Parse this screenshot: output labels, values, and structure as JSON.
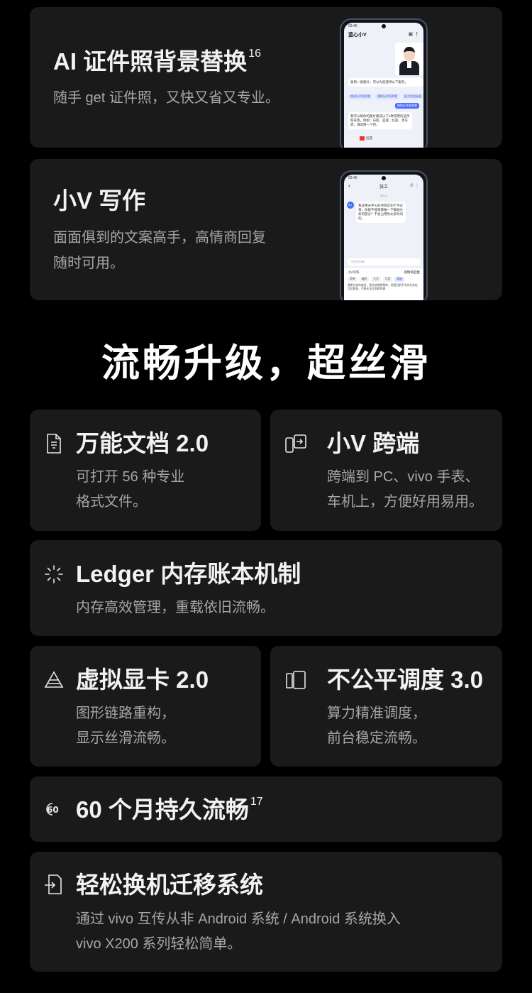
{
  "cards": {
    "ai_photo": {
      "title": "AI 证件照背景替换",
      "sup": "16",
      "desc": "随手 get 证件照，又快又省又专业。"
    },
    "writing": {
      "title": "小V 写作",
      "desc_line1": "面面俱到的文案高手，高情商回复",
      "desc_line2": "随时可用。"
    }
  },
  "phone1": {
    "time": "09:40",
    "app_title": "蓝心小V",
    "msg1": "收到一张图片，可以为您提供以下服务。",
    "chip1": "换成证件照背景",
    "chip2": "替换证件照背景",
    "chip3": "配文发朋友圈",
    "chip_selected": "替换证件照背景",
    "msg2": "我可以帮你的图片换成以下4种常用的证件照背景。例如：白底、蓝底、红底、黑灰底，请选择一个吧。",
    "option": "红底"
  },
  "phone2": {
    "time": "09:40",
    "contact": "张工",
    "timestamp": "09:40",
    "avatar": "张工",
    "msg": "我这两天手头的项目实在忙不过来，你能不能帮我做一下数据分析的部分？不会占用你太多时间的。",
    "input_placeholder": "与你的回复…",
    "panel_title": "小V写作",
    "panel_mode": "高情商回复",
    "tabs": [
      "简单",
      "幽默",
      "正式",
      "可爱",
      "委婉"
    ],
    "reply": "我明白你的难处，我也非常想帮你，但我目前手头的任务也比较紧急，可能无法立即帮你做"
  },
  "section_title": "流畅升级，超丝滑",
  "features": {
    "docs": {
      "icon": "document-icon",
      "title": "万能文档 2.0",
      "desc_line1": "可打开 56 种专业",
      "desc_line2": "格式文件。"
    },
    "cross": {
      "icon": "cross-device-icon",
      "title": "小V 跨端",
      "desc_line1": "跨端到 PC、vivo 手表、",
      "desc_line2": "车机上，方便好用易用。"
    },
    "ledger": {
      "icon": "memory-ledger-icon",
      "title": "Ledger 内存账本机制",
      "desc": "内存高效管理，重载依旧流畅。"
    },
    "gpu": {
      "icon": "gpu-triangle-icon",
      "title": "虚拟显卡 2.0",
      "desc_line1": "图形链路重构，",
      "desc_line2": "显示丝滑流畅。"
    },
    "sched": {
      "icon": "scheduler-icon",
      "title": "不公平调度 3.0",
      "desc_line1": "算力精准调度，",
      "desc_line2": "前台稳定流畅。"
    },
    "sixty": {
      "icon": "sixty-icon",
      "title": "60 个月持久流畅",
      "sup": "17"
    },
    "migrate": {
      "icon": "migrate-icon",
      "title": "轻松换机迁移系统",
      "desc_line1": "通过 vivo 互传从非 Android 系统 / Android 系统换入",
      "desc_line2": "vivo X200 系列轻松简单。"
    }
  },
  "colors": {
    "background": "#000000",
    "card": "#1a1a1a",
    "title": "#f2f2f2",
    "desc": "#a6a6a6"
  }
}
